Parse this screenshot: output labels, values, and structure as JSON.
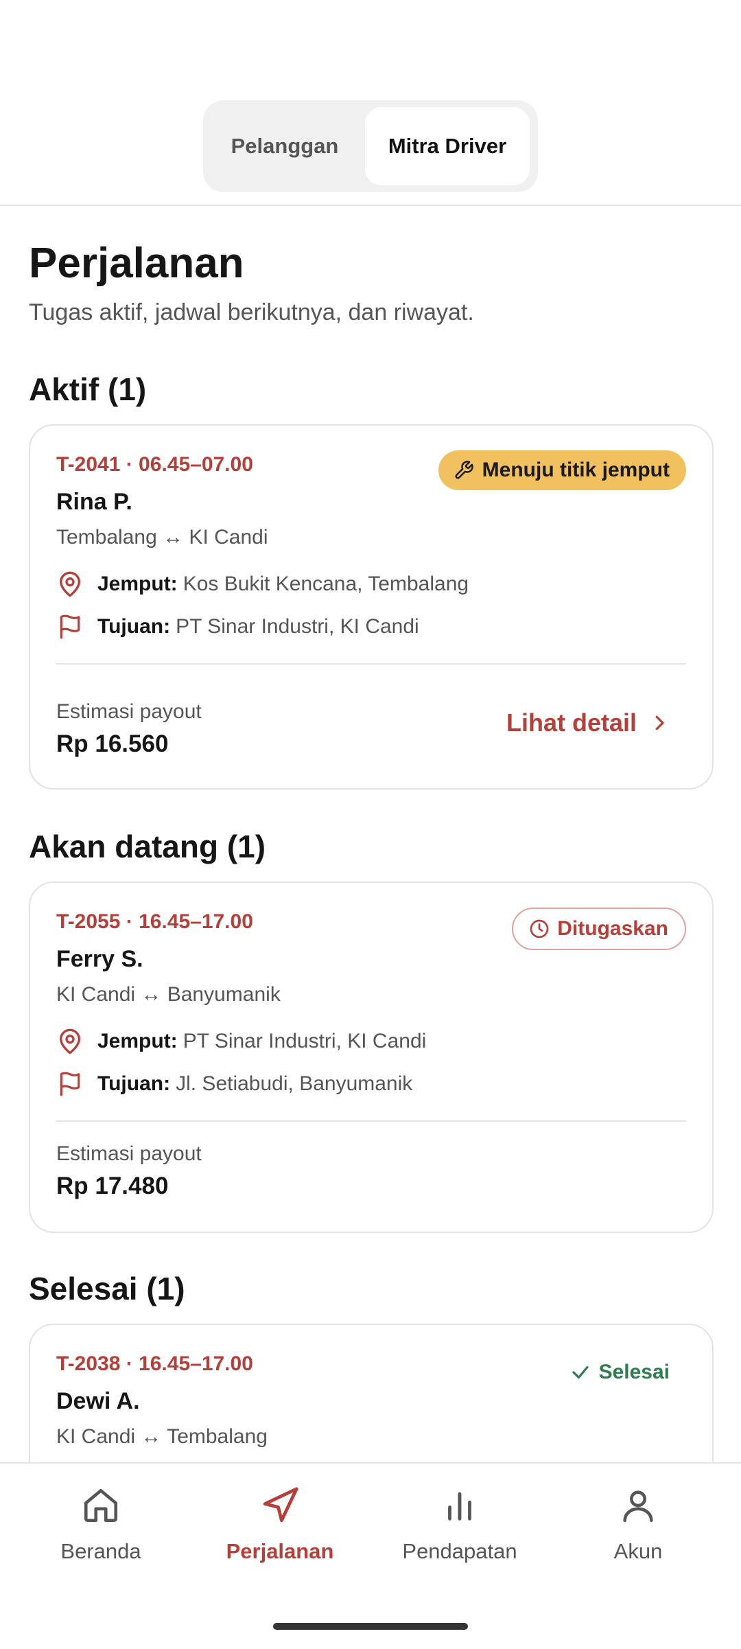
{
  "segment": {
    "left_label": "Pelanggan",
    "right_label": "Mitra Driver",
    "selected": "Mitra Driver"
  },
  "page": {
    "title": "Perjalanan",
    "subtitle": "Tugas aktif, jadwal berikutnya, dan riwayat."
  },
  "sections": {
    "active": {
      "title": "Aktif (1)",
      "trip": {
        "code": "T-2041 · 06.45–07.00",
        "status": "Menuju titik jemput",
        "status_icon": "wrench-icon",
        "passenger": "Rina P.",
        "route": "Tembalang ↔ KI Candi",
        "pickup_label": "Jemput:",
        "pickup": "Kos Bukit Kencana, Tembalang",
        "dest_label": "Tujuan:",
        "dest": "PT Sinar Industri, KI Candi",
        "payout_label": "Estimasi payout",
        "payout": "Rp 16.560",
        "detail_label": "Lihat detail"
      }
    },
    "upcoming": {
      "title": "Akan datang (1)",
      "trip": {
        "code": "T-2055 · 16.45–17.00",
        "status": "Ditugaskan",
        "status_icon": "clock-icon",
        "passenger": "Ferry S.",
        "route": "KI Candi ↔ Banyumanik",
        "pickup_label": "Jemput:",
        "pickup": "PT Sinar Industri, KI Candi",
        "dest_label": "Tujuan:",
        "dest": "Jl. Setiabudi, Banyumanik",
        "payout_label": "Estimasi payout",
        "payout": "Rp 17.480"
      }
    },
    "done": {
      "title": "Selesai (1)",
      "trip": {
        "code": "T-2038 · 16.45–17.00",
        "status": "Selesai",
        "status_icon": "check-icon",
        "passenger": "Dewi A.",
        "route": "KI Candi ↔ Tembalang"
      }
    }
  },
  "nav": {
    "items": [
      {
        "label": "Beranda",
        "icon": "home-icon"
      },
      {
        "label": "Perjalanan",
        "icon": "navigation-icon",
        "active": true
      },
      {
        "label": "Pendapatan",
        "icon": "bar-chart-icon"
      },
      {
        "label": "Akun",
        "icon": "user-icon"
      }
    ]
  },
  "colors": {
    "accent": "#b5403a",
    "badge_yellow": "#f2c15f",
    "success": "#2e7d4f"
  }
}
